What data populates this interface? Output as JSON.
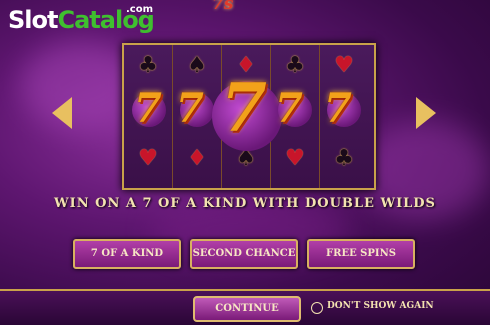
{
  "watermark": {
    "brand_a": "Slot",
    "brand_b": "Catalog",
    "suffix": ".com"
  },
  "game_title": "7s",
  "reels": [
    {
      "top": "♣",
      "top_color": "dark",
      "bottom": "♥",
      "bottom_color": "red",
      "middle": "7"
    },
    {
      "top": "♠",
      "top_color": "dark",
      "bottom": "♦",
      "bottom_color": "red",
      "middle": "7"
    },
    {
      "top": "♦",
      "top_color": "red",
      "bottom": "♠",
      "bottom_color": "dark",
      "middle": "7"
    },
    {
      "top": "♣",
      "top_color": "dark",
      "bottom": "♥",
      "bottom_color": "red",
      "middle": "7"
    },
    {
      "top": "♥",
      "top_color": "red",
      "bottom": "♣",
      "bottom_color": "dark",
      "middle": "7"
    }
  ],
  "message": "WIN ON A 7 OF A KIND WITH DOUBLE WILDS",
  "feature_buttons": [
    "7 OF A KIND",
    "SECOND CHANCE",
    "FREE SPINS"
  ],
  "continue_label": "CONTINUE",
  "dont_show_label": "DON'T SHOW AGAIN",
  "colors": {
    "accent_gold": "#c9a24a",
    "button_purple": "#9a2f96",
    "seven_orange": "#f2a21a"
  }
}
